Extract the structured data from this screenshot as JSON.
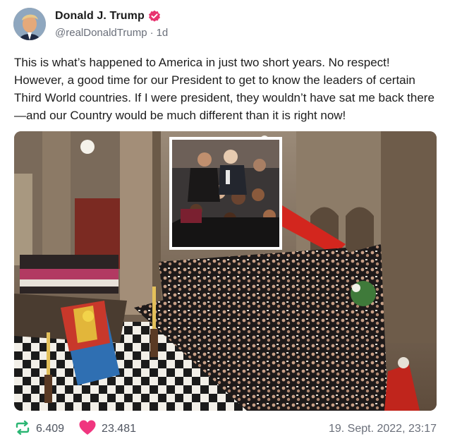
{
  "author": {
    "display_name": "Donald J. Trump",
    "handle": "@realDonaldTrump",
    "age": "1d",
    "verified_icon": "verified-badge-icon"
  },
  "post": {
    "text": "This is what’s happened to America in just two short years. No respect! However, a good time for our President to get to know the leaders of certain Third World countries. If I were president, they wouldn’t have sat me back there—and our Country would be much different than it is right now!"
  },
  "media": {
    "main_image": "photo of a cathedral funeral service: flag-draped coffin on a checkered floor, rows of seated mourners",
    "inset_image": "inset photo of seated attendees in the pews"
  },
  "footer": {
    "repost_count": "6.409",
    "like_count": "23.481",
    "timestamp": "19. Sept. 2022, 23:17"
  },
  "colors": {
    "repost_green": "#2bb673",
    "like_pink": "#f0367f",
    "verified_pink": "#e8336f"
  }
}
